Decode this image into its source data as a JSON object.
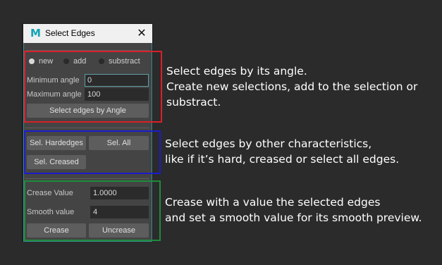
{
  "window": {
    "title": "Select Edges",
    "icon": "maya-m-icon",
    "close_glyph": "✕"
  },
  "selection_mode": {
    "options": [
      "new",
      "add",
      "substract"
    ],
    "selected": "new"
  },
  "angle": {
    "min_label": "Minimum angle",
    "min_value": "0",
    "max_label": "Maximum angle",
    "max_value": "100",
    "select_button": "Select edges by Angle"
  },
  "characteristics": {
    "hardedges_button": "Sel. Hardedges",
    "all_button": "Sel. All",
    "creased_button": "Sel. Creased"
  },
  "crease": {
    "crease_label": "Crease Value",
    "crease_value": "1.0000",
    "smooth_label": "Smooth value",
    "smooth_value": "4",
    "crease_button": "Crease",
    "uncrease_button": "Uncrease"
  },
  "annotations": {
    "angle": [
      "Select edges by its angle.",
      "Create new selections, add to the selection or",
      "substract."
    ],
    "characteristics": [
      "Select edges by other characteristics,",
      "like if it’s hard, creased or select all edges."
    ],
    "crease": [
      "Crease with a value the selected edges",
      "and set a smooth value for its smooth preview."
    ]
  },
  "colors": {
    "background": "#2b2b2b",
    "panel": "#444444",
    "angle_box": "#d7202a",
    "characteristics_box": "#1c1ccc",
    "crease_box": "#1f8a3a",
    "accent": "#12a4b5"
  }
}
